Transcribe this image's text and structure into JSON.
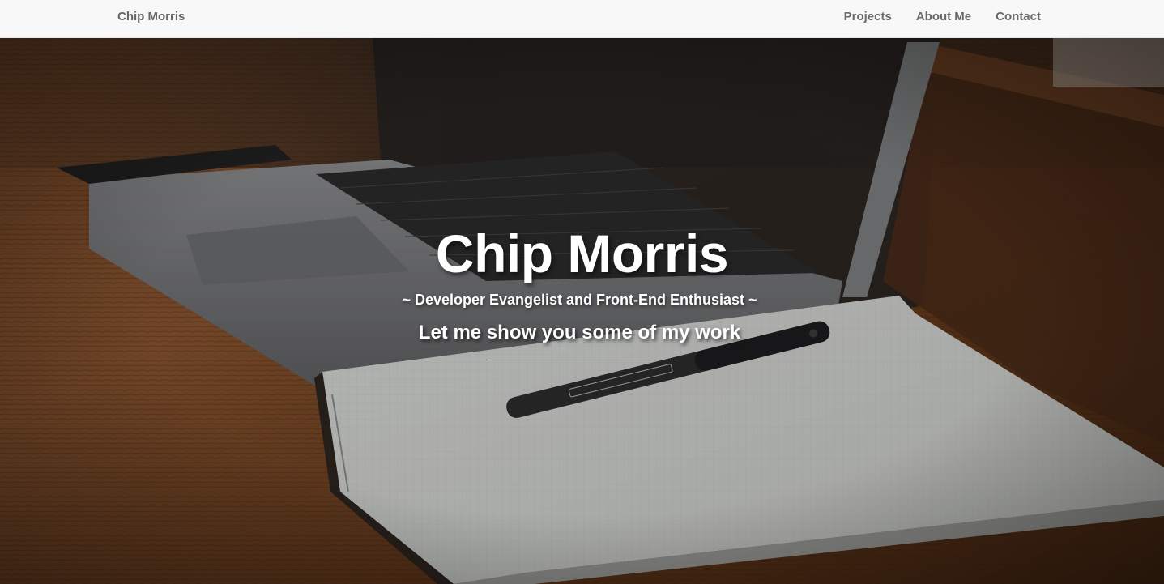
{
  "navbar": {
    "brand": "Chip Morris",
    "links": [
      "Projects",
      "About Me",
      "Contact"
    ]
  },
  "hero": {
    "title": "Chip Morris",
    "subtitle": "~ Developer Evangelist and Front-End Enthusiast ~",
    "cta": "Let me show you some of my work"
  },
  "colors": {
    "navbar_bg": "#f8f8f8",
    "nav_text": "#6a6a6a",
    "hero_text": "#ffffff",
    "wood": "#6b3d1e"
  }
}
